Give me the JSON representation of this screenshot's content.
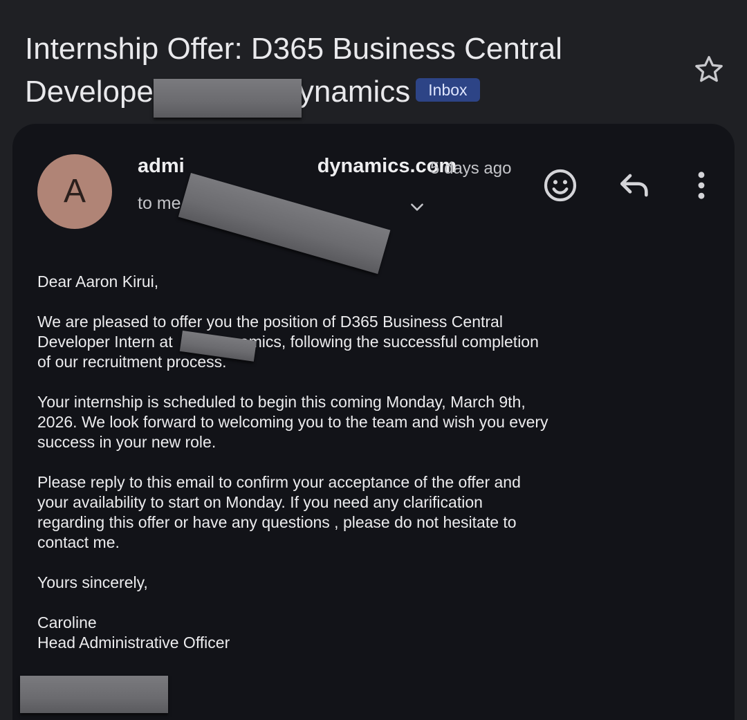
{
  "subject": {
    "line1": "Internship Offer: D365 Business Central",
    "line2_start": "Develope",
    "line2_end": "ynamics",
    "label": "Inbox"
  },
  "sender": {
    "avatar_letter": "A",
    "email_start": "admi",
    "email_end": "dynamics.com",
    "time": "5 days ago",
    "recipients": "to me, Ka"
  },
  "body": {
    "greeting": "Dear Aaron Kirui,",
    "p1_line1": "We are pleased to offer you the position of D365 Business Central",
    "p1_line2_start": "Developer Intern at ",
    "p1_line2_end": "namics, following the successful completion",
    "p1_line3": "of our recruitment process.",
    "p2_line1": "Your internship is scheduled to begin this coming Monday, March 9th,",
    "p2_line2": "2026. We look forward to welcoming you to the team and wish you every",
    "p2_line3": "success in your new role.",
    "p3_line1": "Please reply to this email to confirm your acceptance of the offer and",
    "p3_line2": "your availability to start on Monday. If you need any clarification",
    "p3_line3": "regarding this offer or have any questions , please do not hesitate to",
    "p3_line4": "contact me.",
    "closing": "Yours sincerely,",
    "signature_name": "Caroline",
    "signature_title": "Head Administrative Officer"
  },
  "colors": {
    "background": "#1f2024",
    "card": "#121318",
    "badge": "#2d4486",
    "avatar": "#b08476",
    "redaction": "#6e6e72"
  },
  "icons": [
    "star-icon",
    "emoji-icon",
    "reply-icon",
    "more-vert-icon",
    "chevron-down-icon"
  ]
}
